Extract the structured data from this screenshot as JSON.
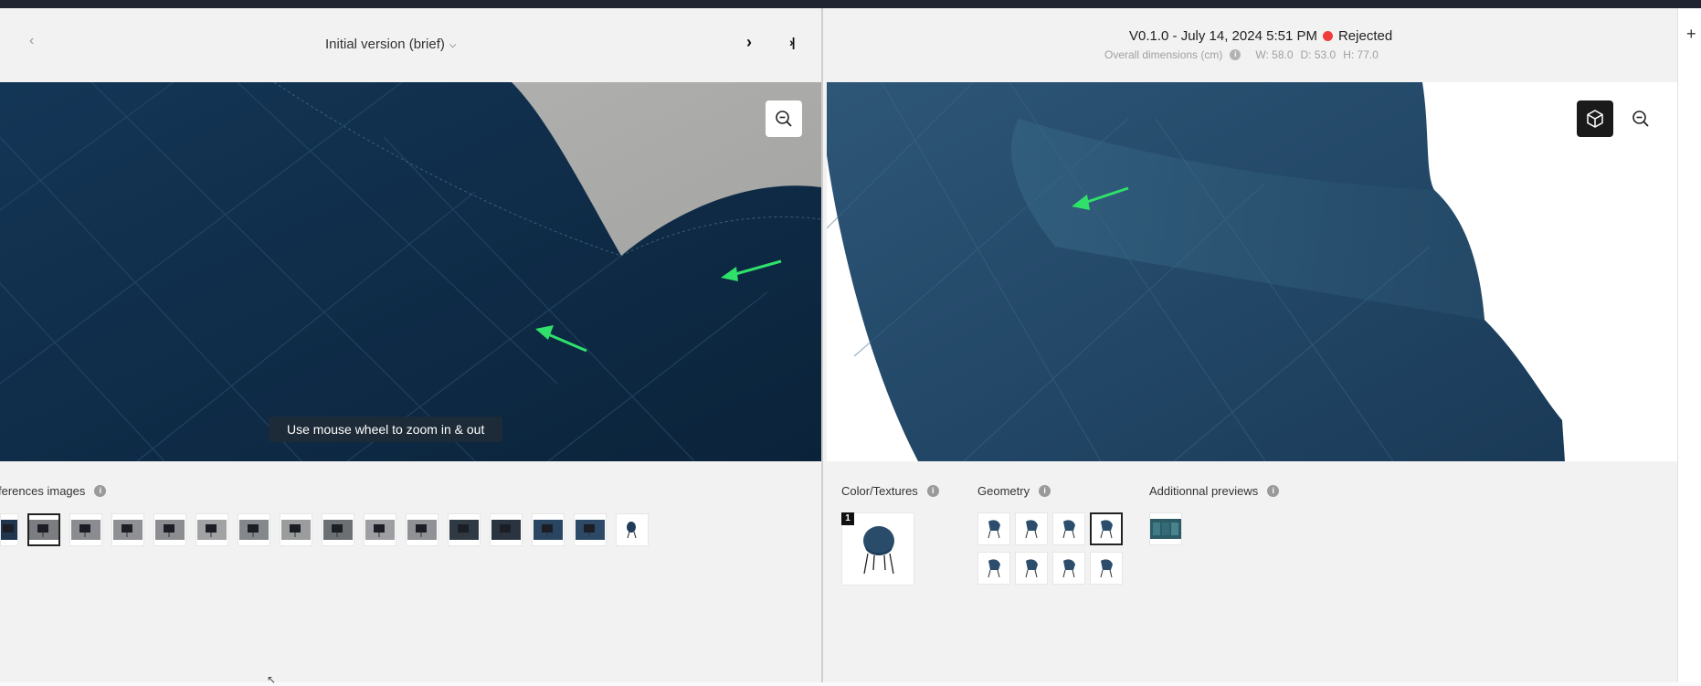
{
  "left": {
    "nav_prev": "‹",
    "version_select": "Initial version (brief)",
    "nav_next": "›",
    "nav_last": "›|",
    "zoom_hint": "Use mouse wheel to zoom in & out",
    "references_label": "ferences images",
    "reference_thumb_count": 16,
    "selected_reference_index": 1
  },
  "right": {
    "version": "V0.1.0 - July 14, 2024 5:51 PM",
    "status": "Rejected",
    "status_color": "#ef3b3b",
    "dims_label": "Overall dimensions (cm)",
    "dims_w": "W: 58.0",
    "dims_d": "D: 53.0",
    "dims_h": "H: 77.0",
    "color_textures_label": "Color/Textures",
    "color_badge": "1",
    "geometry_label": "Geometry",
    "geometry_count": 8,
    "selected_geometry_index": 3,
    "previews_label": "Additionnal previews"
  },
  "icons": {
    "zoom_out": "zoom-out-icon",
    "cube": "cube-icon",
    "info": "info-icon",
    "plus": "plus-icon",
    "dropdown": "chevron-down-icon"
  },
  "colors": {
    "fabric": "#1a3f60",
    "arrow": "#2fe06a",
    "topbar": "#1f2430"
  }
}
